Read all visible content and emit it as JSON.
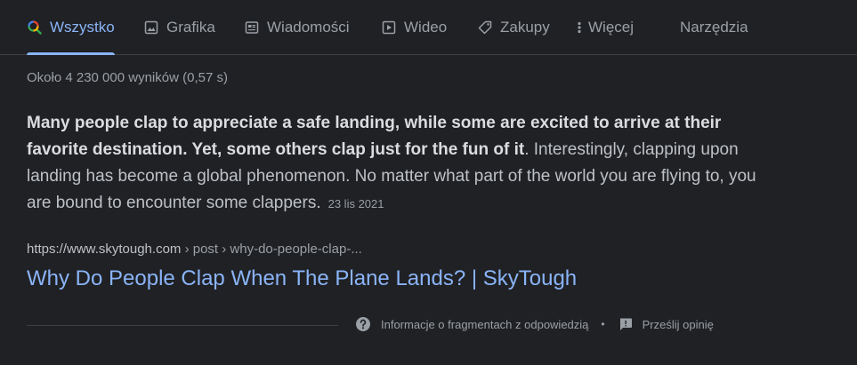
{
  "tabs": [
    {
      "label": "Wszystko",
      "icon": "search-icon",
      "active": true
    },
    {
      "label": "Grafika",
      "icon": "image-icon"
    },
    {
      "label": "Wiadomości",
      "icon": "news-icon"
    },
    {
      "label": "Wideo",
      "icon": "video-icon"
    },
    {
      "label": "Zakupy",
      "icon": "tag-icon"
    },
    {
      "label": "Więcej",
      "icon": "more-vert-icon"
    },
    {
      "label": "Narzędzia"
    }
  ],
  "result_stats": "Około 4 230 000 wyników (0,57 s)",
  "snippet": {
    "bold_text": "Many people clap to appreciate a safe landing, while some are excited to arrive at their favorite destination. Yet, some others clap just for the fun of it",
    "text": ". Interestingly, clapping upon landing has become a global phenomenon. No matter what part of the world you are flying to, you are bound to encounter some clappers.",
    "date": "23 lis 2021"
  },
  "result": {
    "domain": "https://www.skytough.com",
    "path": " › post › why-do-people-clap-...",
    "title": "Why Do People Clap When The Plane Lands? | SkyTough"
  },
  "footer": {
    "about_label": "Informacje o fragmentach z odpowiedzią",
    "separator": "•",
    "feedback_label": "Prześlij opinię"
  },
  "colors": {
    "background": "#202124",
    "link": "#8ab4f8",
    "text": "#bdc1c6",
    "muted": "#9aa0a6"
  }
}
